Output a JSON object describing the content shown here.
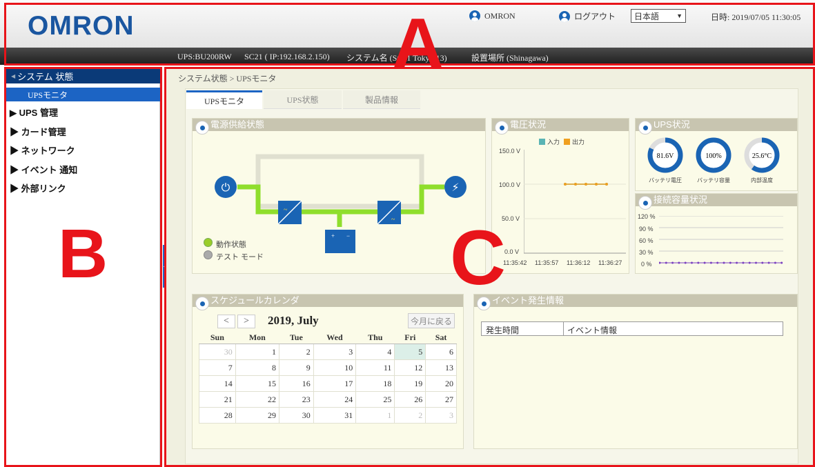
{
  "header": {
    "logo": "OMRON",
    "user_label": "OMRON",
    "logout_label": "ログアウト",
    "language": "日本語",
    "datetime": "日時: 2019/07/05 11:30:05"
  },
  "infobar": {
    "ups_model": "UPS:BU200RW",
    "card": "SC21 ( IP:192.168.2.150)",
    "system_name": "システム名 (SC21 Tokyo 13)",
    "location": "設置場所 (Shinagawa)"
  },
  "sidebar": {
    "section": "システム 状態",
    "section_arrow": "◀",
    "active_sub": "UPSモニタ",
    "items": [
      "▶ UPS 管理",
      "▶ カード管理",
      "▶ ネットワーク",
      "▶ イベント 通知",
      "▶ 外部リンク"
    ],
    "collapse_icon": "double-chevron-left-icon"
  },
  "breadcrumb": "システム状態 > UPSモニタ",
  "tabs": [
    "UPSモニタ",
    "UPS状態",
    "製品情報"
  ],
  "power_supply": {
    "title": "電源供給状態",
    "legend": [
      "動作状態",
      "テスト モード"
    ]
  },
  "voltage": {
    "title": "電圧状況",
    "legend": [
      "入力",
      "出力"
    ],
    "chart_data": {
      "type": "line",
      "x": [
        "11:35:42",
        "11:35:57",
        "11:36:12",
        "11:36:27"
      ],
      "y_ticks": [
        "150.0 V",
        "100.0 V",
        "50.0 V",
        "0.0 V"
      ],
      "series": [
        {
          "name": "入力",
          "values": [
            100,
            100,
            100,
            100,
            100
          ],
          "color": "#5ab4b4"
        },
        {
          "name": "出力",
          "values": [
            100,
            100,
            100,
            100,
            100
          ],
          "color": "#f0a020"
        }
      ]
    }
  },
  "ups_status": {
    "title": "UPS状況",
    "gauges": [
      {
        "value": "81.6V",
        "label": "バッテリ電圧",
        "fill": 0.82
      },
      {
        "value": "100%",
        "label": "バッテリ容量",
        "fill": 1.0
      },
      {
        "value": "25.6°C",
        "label": "内部温度",
        "fill": 0.6
      }
    ]
  },
  "load": {
    "title": "接続容量状況",
    "y_ticks": [
      "120 %",
      "90 %",
      "60 %",
      "30 %",
      "0 %"
    ],
    "chart_data": {
      "type": "line",
      "values": [
        0,
        0,
        0,
        0,
        0,
        0,
        0,
        0,
        0,
        0,
        0,
        0,
        0,
        0,
        0,
        0,
        0,
        0,
        0,
        0
      ]
    }
  },
  "calendar": {
    "title": "スケジュールカレンダ",
    "prev": "<",
    "next": ">",
    "month_label": "2019, July",
    "today_label": "今月に戻る",
    "weekdays": [
      "Sun",
      "Mon",
      "Tue",
      "Wed",
      "Thu",
      "Fri",
      "Sat"
    ],
    "weeks": [
      [
        "30",
        "1",
        "2",
        "3",
        "4",
        "5",
        "6"
      ],
      [
        "7",
        "8",
        "9",
        "10",
        "11",
        "12",
        "13"
      ],
      [
        "14",
        "15",
        "16",
        "17",
        "18",
        "19",
        "20"
      ],
      [
        "21",
        "22",
        "23",
        "24",
        "25",
        "26",
        "27"
      ],
      [
        "28",
        "29",
        "30",
        "31",
        "1",
        "2",
        "3"
      ]
    ]
  },
  "events": {
    "title": "イベント発生情報",
    "columns": [
      "発生時間",
      "イベント情報"
    ]
  },
  "overlay_labels": {
    "a": "A",
    "b": "B",
    "c": "C"
  },
  "colors": {
    "accent": "#1c64c4",
    "annotation": "#e8141a",
    "line_green": "#8fde2c"
  }
}
